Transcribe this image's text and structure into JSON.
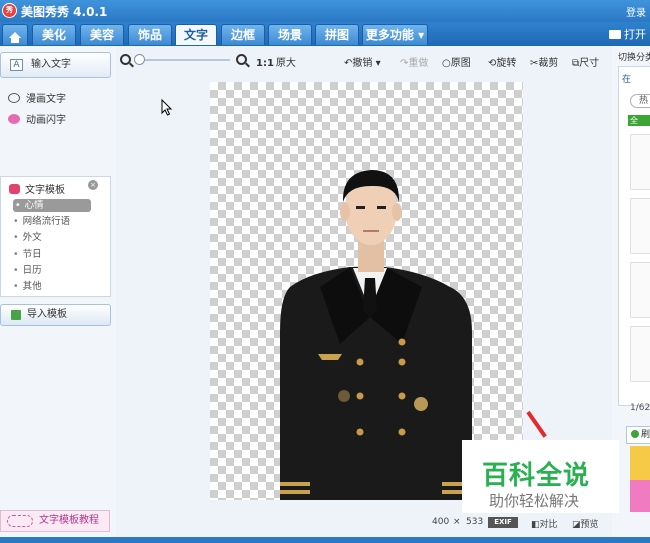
{
  "app": {
    "title": "美图秀秀 4.0.1",
    "logo_text": "秀",
    "login": "登录",
    "open": "打开"
  },
  "nav": {
    "tabs": [
      "美化",
      "美容",
      "饰品",
      "文字",
      "边框",
      "场景",
      "拼图",
      "更多功能"
    ],
    "active_tab": "文字"
  },
  "left": {
    "input_text": "输入文字",
    "comic_text": "漫画文字",
    "animated_text": "动画闪字",
    "template_header": "文字模板",
    "categories": [
      "心情",
      "网络流行语",
      "外文",
      "节日",
      "日历",
      "其他"
    ],
    "selected_category": "心情",
    "import_template": "导入模板",
    "tutorial": "文字模板教程"
  },
  "toolbar": {
    "zoom_ratio": "1:1",
    "original_size": "原大",
    "undo": "撤销",
    "redo": "重做",
    "original_image": "原图",
    "rotate": "旋转",
    "crop": "裁剪",
    "size": "尺寸"
  },
  "status": {
    "width": "400",
    "x": "×",
    "height": "533",
    "exif": "EXIF",
    "compare": "对比",
    "preview": "预览"
  },
  "right": {
    "title": "切换分类",
    "tab_label": "在",
    "pill": "热",
    "green_tag": "全",
    "page_indicator": "1/62",
    "button": "刷"
  },
  "watermark": {
    "title": "百科全说",
    "subtitle": "助你轻松解决"
  },
  "colors": {
    "title_bar": "#2b78c4",
    "active_tab_text": "#1f5d9e",
    "watermark_green": "#29b050",
    "arrow_red": "#e22a2a"
  }
}
